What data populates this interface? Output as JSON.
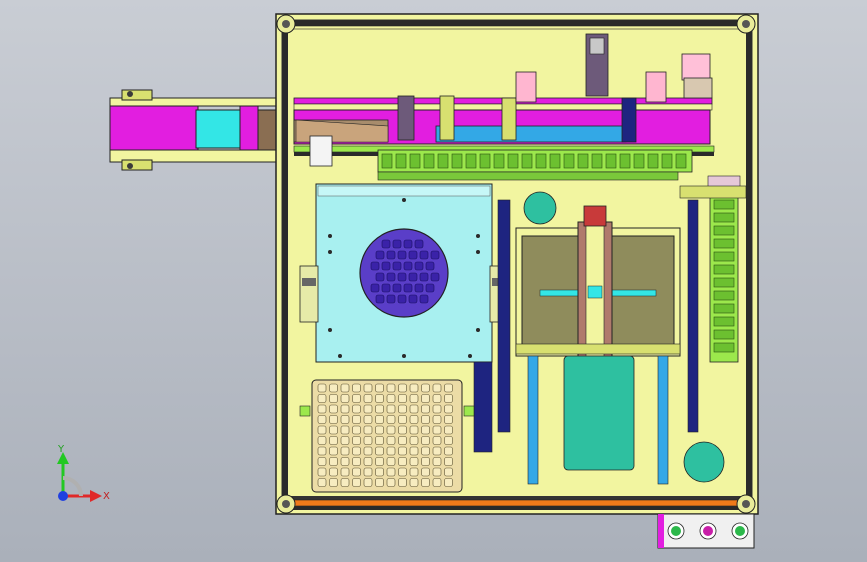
{
  "viewport": {
    "background_top": "#c9cdd4",
    "background_bottom": "#aab0ba"
  },
  "colors": {
    "frame": "#f2f5a0",
    "outline": "#1a1a1a",
    "table_cyan": "#a8f0f0",
    "wafer_purple": "#5a3ec8",
    "magenta": "#e21ee0",
    "cyan": "#33e6e6",
    "olive_plate": "#8f8c5c",
    "brown": "#b07a6c",
    "green_chain": "#9ce84c",
    "navy_rail": "#1e2480",
    "teal_round": "#2ec0a0",
    "orange_rail": "#f07a1a",
    "tray": "#ecdca6",
    "axis_y": "#22c822",
    "axis_x": "#e02828",
    "axis_origin": "#2040e0"
  },
  "triad": {
    "x_label": "X",
    "y_label": "Y"
  },
  "control_panel": {
    "buttons": [
      "green-button",
      "magenta-button",
      "green-button"
    ]
  }
}
